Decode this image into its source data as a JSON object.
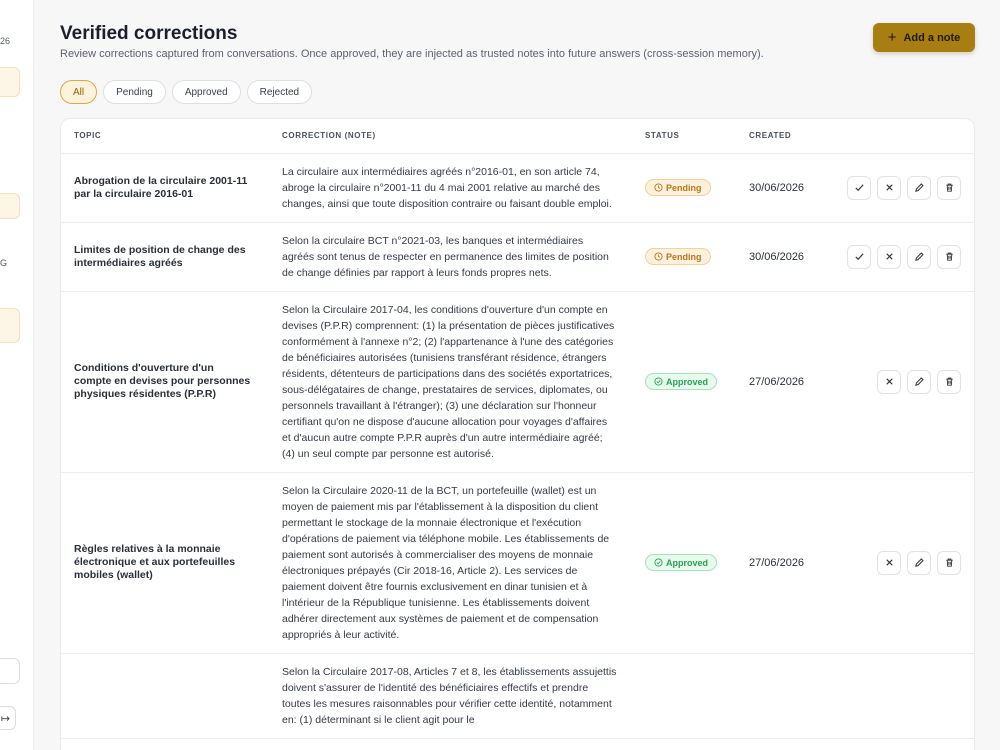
{
  "sidebar": {
    "fragments": [
      "26",
      "G"
    ]
  },
  "header": {
    "title": "Verified corrections",
    "subtitle": "Review corrections captured from conversations. Once approved, they are injected as trusted notes into future answers (cross-session memory).",
    "add_button": "Add a note",
    "add_icon": "plus-icon"
  },
  "filters": [
    {
      "label": "All",
      "active": true
    },
    {
      "label": "Pending",
      "active": false
    },
    {
      "label": "Approved",
      "active": false
    },
    {
      "label": "Rejected",
      "active": false
    }
  ],
  "table": {
    "columns": [
      "TOPIC",
      "CORRECTION (NOTE)",
      "STATUS",
      "CREATED"
    ],
    "rows": [
      {
        "topic": "Abrogation de la circulaire 2001-11 par la circulaire 2016-01",
        "note": "La circulaire aux intermédiaires agréés n°2016-01, en son article 74, abroge la circulaire n°2001-11 du 4 mai 2001 relative au marché des changes, ainsi que toute disposition contraire ou faisant double emploi.",
        "status": "Pending",
        "created": "30/06/2026"
      },
      {
        "topic": "Limites de position de change des intermédiaires agréés",
        "note": "Selon la circulaire BCT n°2021-03, les banques et intermédiaires agréés sont tenus de respecter en permanence des limites de position de change définies par rapport à leurs fonds propres nets.",
        "status": "Pending",
        "created": "30/06/2026"
      },
      {
        "topic": "Conditions d'ouverture d'un compte en devises pour personnes physiques résidentes (P.P.R)",
        "note": "Selon la Circulaire 2017-04, les conditions d'ouverture d'un compte en devises (P.P.R) comprennent: (1) la présentation de pièces justificatives conformément à l'annexe n°2; (2) l'appartenance à l'une des catégories de bénéficiaires autorisées (tunisiens transférant résidence, étrangers résidents, détenteurs de participations dans des sociétés exportatrices, sous-délégataires de change, prestataires de services, diplomates, ou personnels travaillant à l'étranger); (3) une déclaration sur l'honneur certifiant qu'on ne dispose d'aucune allocation pour voyages d'affaires et d'aucun autre compte P.P.R auprès d'un autre intermédiaire agréé; (4) un seul compte par personne est autorisé.",
        "status": "Approved",
        "created": "27/06/2026"
      },
      {
        "topic": "Règles relatives à la monnaie électronique et aux portefeuilles mobiles (wallet)",
        "note": "Selon la Circulaire 2020-11 de la BCT, un portefeuille (wallet) est un moyen de paiement mis par l'établissement à la disposition du client permettant le stockage de la monnaie électronique et l'exécution d'opérations de paiement via téléphone mobile. Les établissements de paiement sont autorisés à commercialiser des moyens de monnaie électroniques prépayés (Cir 2018-16, Article 2). Les services de paiement doivent être fournis exclusivement en dinar tunisien et à l'intérieur de la République tunisienne. Les établissements doivent adhérer directement aux systèmes de paiement et de compensation appropriés à leur activité.",
        "status": "Approved",
        "created": "27/06/2026"
      },
      {
        "topic": "",
        "note": "Selon la Circulaire 2017-08, Articles 7 et 8, les établissements assujettis doivent s'assurer de l'identité des bénéficiaires effectifs et prendre toutes les mesures raisonnables pour vérifier cette identité, notamment en: (1) déterminant si le client agit pour le",
        "status": "",
        "created": ""
      }
    ]
  },
  "colors": {
    "accent": "#a87d12",
    "pending": "#b8761b",
    "approved": "#28a157"
  }
}
